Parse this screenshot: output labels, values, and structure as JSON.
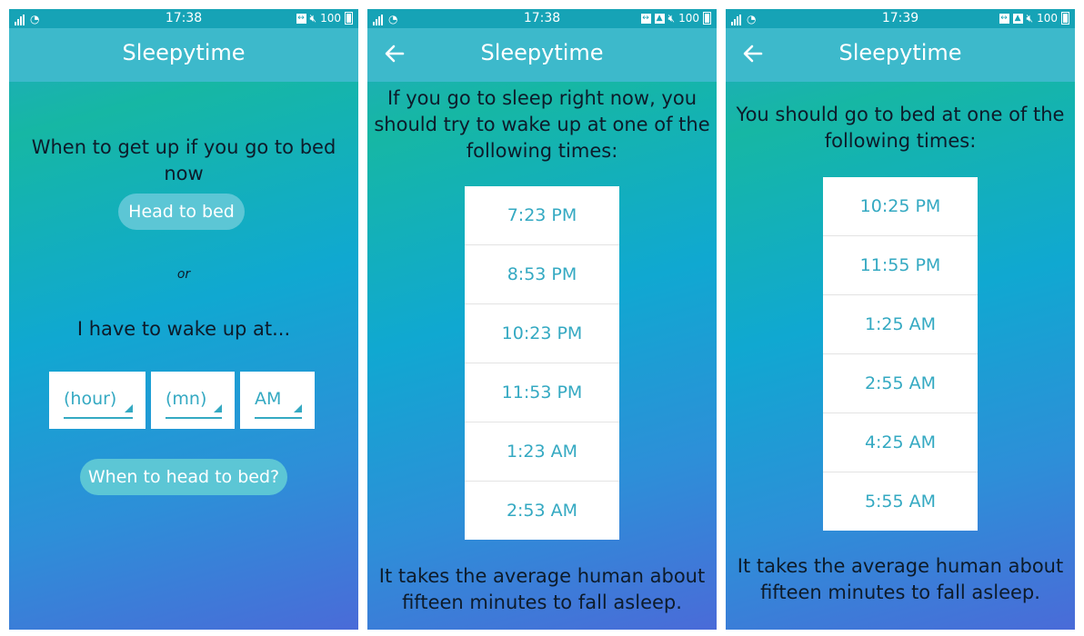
{
  "screens": [
    {
      "status": {
        "time": "17:38",
        "battery": "100"
      },
      "title": "Sleepytime",
      "prompt": "When to get up if you go to bed now",
      "bed_button": "Head to bed",
      "or_label": "or",
      "wake_prompt": "I have to wake up at...",
      "selects": {
        "hour": "(hour)",
        "minute": "(mn)",
        "ampm": "AM"
      },
      "calc_button": "When to head to bed?"
    },
    {
      "status": {
        "time": "17:38",
        "battery": "100"
      },
      "title": "Sleepytime",
      "heading_lines": [
        "If you go to sleep right now, you",
        "should try to wake up at one of the",
        "following times:"
      ],
      "times": [
        "7:23 PM",
        "8:53 PM",
        "10:23 PM",
        "11:53 PM",
        "1:23 AM",
        "2:53 AM"
      ],
      "footer_lines": [
        "It takes the average human about",
        "fifteen minutes to fall asleep."
      ]
    },
    {
      "status": {
        "time": "17:39",
        "battery": "100"
      },
      "title": "Sleepytime",
      "heading_lines": [
        "You should go to bed at one of the",
        "following times:"
      ],
      "times": [
        "10:25 PM",
        "11:55 PM",
        "1:25 AM",
        "2:55 AM",
        "4:25 AM",
        "5:55 AM"
      ],
      "footer_lines": [
        "It takes the average human about",
        "fifteen minutes to fall asleep."
      ]
    }
  ],
  "colors": {
    "accent": "#34a9c2",
    "title_bar": "#3db9cb",
    "status_bar": "#16a3b6",
    "pill": "#5cc6d5"
  }
}
